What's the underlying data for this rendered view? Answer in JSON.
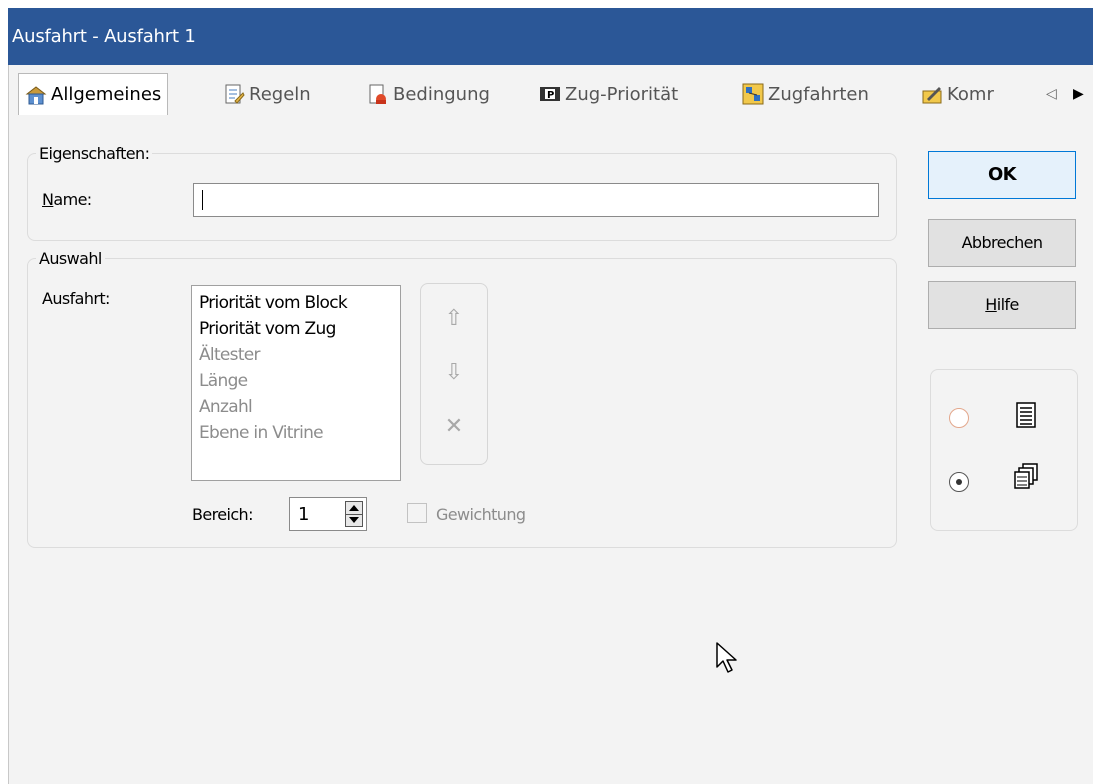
{
  "window": {
    "title": "Ausfahrt - Ausfahrt 1"
  },
  "tabs": [
    {
      "label": "Allgemeines",
      "icon": "properties-icon",
      "active": true
    },
    {
      "label": "Regeln",
      "icon": "rules-icon",
      "active": false
    },
    {
      "label": "Bedingung",
      "icon": "condition-icon",
      "active": false
    },
    {
      "label": "Zug-Priorität",
      "icon": "train-priority-icon",
      "active": false
    },
    {
      "label": "Zugfahrten",
      "icon": "train-routes-icon",
      "active": false
    },
    {
      "label": "Komr",
      "icon": "comment-icon",
      "active": false
    }
  ],
  "tab_nav": {
    "left": "◁",
    "right": "▶"
  },
  "eigenschaften": {
    "legend": "Eigenschaften:",
    "name_label": "ame:",
    "name_accel": "N",
    "name_value": ""
  },
  "auswahl": {
    "legend": "Auswahl",
    "ausfahrt_label": "Ausfahrt:",
    "list_items": [
      {
        "text": "Priorität vom Block",
        "enabled": true
      },
      {
        "text": "Priorität vom Zug",
        "enabled": true
      },
      {
        "text": "Ältester",
        "enabled": false
      },
      {
        "text": "Länge",
        "enabled": false
      },
      {
        "text": "Anzahl",
        "enabled": false
      },
      {
        "text": "Ebene in Vitrine",
        "enabled": false
      }
    ],
    "move_up": "⇧",
    "move_down": "⇩",
    "remove": "✕",
    "bereich_label": "Bereich:",
    "bereich_value": "1",
    "gewichtung_label": "Gewichtung",
    "gewichtung_checked": false
  },
  "buttons": {
    "ok": "OK",
    "cancel": "Abbrechen",
    "help_accel": "H",
    "help_rest": "ilfe"
  },
  "view_mode": {
    "options": [
      {
        "icon": "list-view-icon",
        "selected": false
      },
      {
        "icon": "cascade-view-icon",
        "selected": true
      }
    ]
  },
  "colors": {
    "titlebar": "#2b5797",
    "default_button": "#0078d7"
  }
}
